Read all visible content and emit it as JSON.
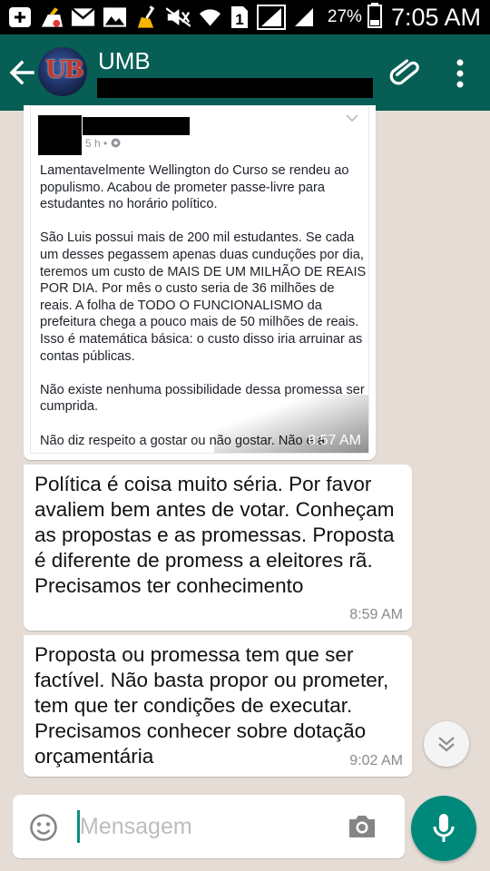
{
  "status_bar": {
    "battery_percent": "27%",
    "time": "7:05 AM",
    "sim_slot": "1",
    "icons": [
      "add-icon",
      "cleaner-icon",
      "mail-icon",
      "gallery-icon",
      "broom-icon",
      "mute-icon",
      "wifi-icon",
      "sim-icon",
      "signal-icon",
      "signal-icon",
      "battery-icon"
    ]
  },
  "header": {
    "contact_name": "UMB",
    "avatar_mark": "UB",
    "accent": "#075e54"
  },
  "chat": {
    "image_message": {
      "fb_post": {
        "time": "5 h •",
        "paragraphs": [
          "Lamentavelmente Wellington do Curso se rendeu ao populismo. Acabou de prometer passe-livre para estudantes no horário político.",
          "São Luis possui mais de 200 mil estudantes. Se cada um desses pegassem apenas duas cunduções por dia, teremos um custo de MAIS DE UM MILHÃO DE REAIS POR DIA. Por mês o custo seria de 36 milhões de reais. A folha de TODO O FUNCIONALISMO da prefeitura chega a pouco mais de 50 milhões de reais. Isso é matemática básica: o custo disso iria arruinar as contas públicas.",
          "Não existe nenhuma possibilidade dessa promessa ser cumprida.",
          "Não diz respeito a gostar ou não gostar. Não é a"
        ]
      },
      "time": "8:57 AM"
    },
    "messages": [
      {
        "text": "Política é coisa muito séria. Por favor avaliem bem antes de votar. Conheçam as propostas e as promessas. Proposta é diferente de promess a eleitores rã.  Precisamos ter conhecimento",
        "time": "8:59 AM"
      },
      {
        "text": "Proposta ou promessa tem que ser factível. Não basta propor ou prometer, tem que ter condições de executar. Precisamos conhecer sobre dotação orçamentária",
        "time": "9:02 AM"
      }
    ]
  },
  "input": {
    "placeholder": "Mensagem",
    "value": "",
    "send_color": "#00897b"
  }
}
